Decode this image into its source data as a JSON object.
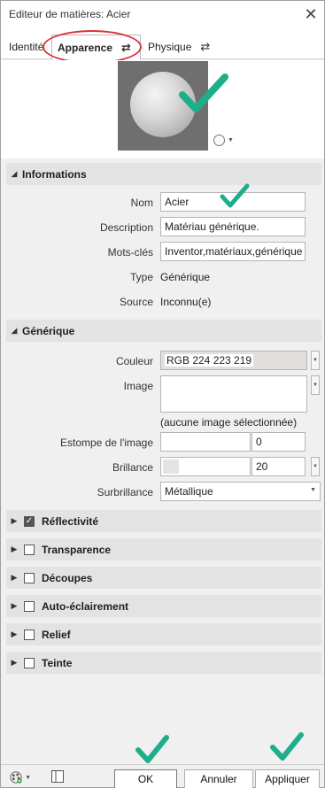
{
  "window": {
    "title": "Editeur de matières: Acier",
    "close_glyph": "✕"
  },
  "tabs": [
    {
      "label": "Identité"
    },
    {
      "label": "Apparence",
      "active": true
    },
    {
      "label": "Physique"
    }
  ],
  "icons": {
    "swap": "⇄",
    "triangle_down": "◢",
    "triangle_right": "▶",
    "spin_down": "▼",
    "check": "✓"
  },
  "informations": {
    "header": "Informations",
    "rows": [
      {
        "label": "Nom",
        "value": "Acier"
      },
      {
        "label": "Description",
        "value": "Matériau générique."
      },
      {
        "label": "Mots-clés",
        "value": "Inventor,matériaux,générique"
      },
      {
        "label": "Type",
        "value": "Générique"
      },
      {
        "label": "Source",
        "value": "Inconnu(e)"
      }
    ]
  },
  "generique": {
    "header": "Générique",
    "couleur_label": "Couleur",
    "couleur_value": "RGB 224 223 219",
    "couleur_hex": "#e0dfdb",
    "image_label": "Image",
    "image_caption": "(aucune image sélectionnée)",
    "estompe_label": "Estompe de l'image",
    "estompe_value": "0",
    "brillance_label": "Brillance",
    "brillance_value": "20",
    "surbrillance_label": "Surbrillance",
    "surbrillance_value": "Métallique"
  },
  "sections": [
    {
      "label": "Réflectivité",
      "checked": true
    },
    {
      "label": "Transparence",
      "checked": false
    },
    {
      "label": "Découpes",
      "checked": false
    },
    {
      "label": "Auto-éclairement",
      "checked": false
    },
    {
      "label": "Relief",
      "checked": false
    },
    {
      "label": "Teinte",
      "checked": false
    }
  ],
  "buttons": {
    "ok": "OK",
    "annuler": "Annuler",
    "appliquer": "Appliquer"
  },
  "colors": {
    "highlight": "#d9333b",
    "checkmark": "#1fae8c"
  }
}
